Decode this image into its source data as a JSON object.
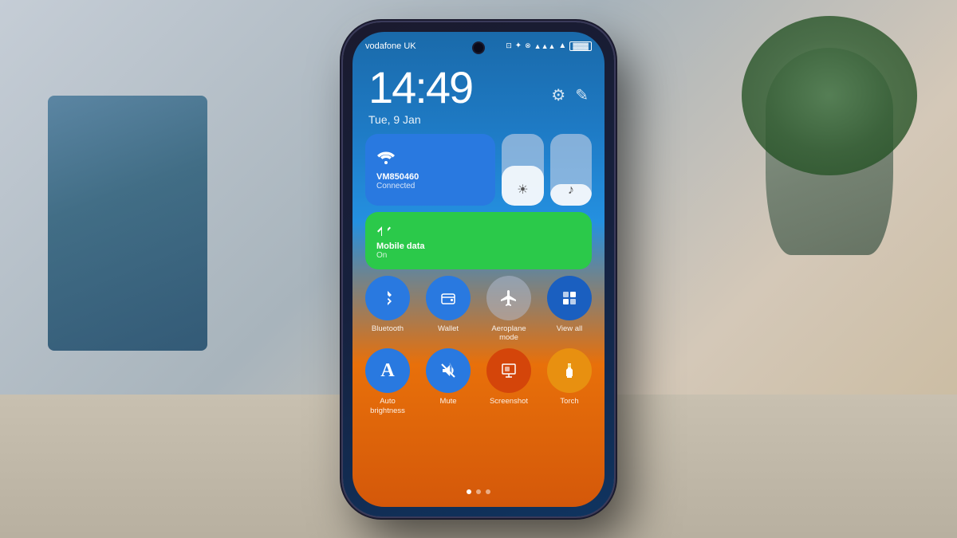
{
  "scene": {
    "background_color": "#b0b8c0"
  },
  "phone": {
    "carrier": "vodafone UK",
    "time": "14:49",
    "date": "Tue, 9 Jan",
    "status_icons": [
      "⬛",
      "bluetooth",
      "wifi",
      "signal",
      "battery"
    ],
    "wifi_tile": {
      "name": "VM850460",
      "status": "Connected",
      "icon": "wifi"
    },
    "mobile_tile": {
      "name": "Mobile data",
      "status": "On",
      "icon": "signal"
    },
    "brightness_label": "☀",
    "music_label": "♪",
    "circle_buttons_row1": [
      {
        "id": "bluetooth",
        "label": "Bluetooth",
        "icon": "bluetooth"
      },
      {
        "id": "wallet",
        "label": "Wallet",
        "icon": "wallet"
      },
      {
        "id": "aeroplane",
        "label": "Aeroplane mode",
        "icon": "✈"
      },
      {
        "id": "viewall",
        "label": "View all",
        "icon": "grid"
      }
    ],
    "circle_buttons_row2": [
      {
        "id": "autobrightness",
        "label": "Auto brightness",
        "icon": "A"
      },
      {
        "id": "mute",
        "label": "Mute",
        "icon": "🔕"
      },
      {
        "id": "screenshot",
        "label": "Screenshot",
        "icon": "⊞"
      },
      {
        "id": "torch",
        "label": "Torch",
        "icon": "🔦"
      }
    ],
    "dots": [
      {
        "active": true
      },
      {
        "active": false
      },
      {
        "active": false
      }
    ]
  }
}
